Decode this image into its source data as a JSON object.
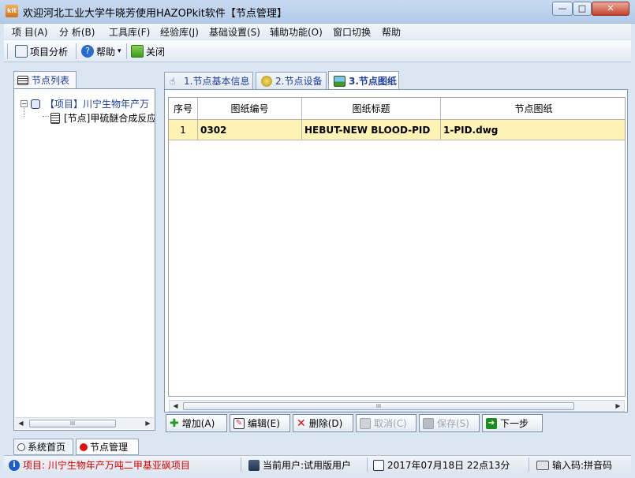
{
  "window": {
    "title": "欢迎河北工业大学牛晓芳使用HAZOPkit软件【节点管理】",
    "app_icon_text": "kit",
    "controls": {
      "minimize": "—",
      "maximize": "□",
      "close": "✕"
    }
  },
  "menubar": {
    "items": [
      "项 目(A)",
      "分 析(B)",
      "工具库(F)",
      "经验库(J)",
      "基础设置(S)",
      "辅助功能(O)",
      "窗口切换",
      "帮助"
    ]
  },
  "toolbar": {
    "analysis_label": "项目分析",
    "help_label": "帮助",
    "help_arrow": "▾",
    "close_label": "关闭"
  },
  "left_panel": {
    "tab_label": "节点列表",
    "tree": {
      "project_label": "【项目】川宁生物年产万",
      "node_label": "[节点]甲硫醚合成反应",
      "expand_sign": "−"
    },
    "scroll_thumb": "III"
  },
  "tabs": [
    "1.节点基本信息",
    "2.节点设备",
    "3.节点图纸"
  ],
  "active_tab": 2,
  "grid": {
    "columns": [
      "序号",
      "图纸编号",
      "图纸标题",
      "节点图纸"
    ],
    "rows": [
      {
        "index": "1",
        "drawing_no": "0302",
        "title": "HEBUT-NEW BLOOD-PID",
        "file": "1-PID.dwg"
      }
    ],
    "scroll_thumb": "III"
  },
  "actions": {
    "add": "增加(A)",
    "edit": "编辑(E)",
    "delete": "删除(D)",
    "cancel": "取消(C)",
    "save": "保存(S)",
    "next": "下一步"
  },
  "bottom_tabs": [
    "系统首页",
    "节点管理"
  ],
  "status": {
    "project": "项目: 川宁生物年产万吨二甲基亚砜项目",
    "user": "当前用户:试用版用户",
    "datetime": "2017年07月18日  22点13分",
    "input": "输入码:拼音码"
  },
  "colors": {
    "status_project": "#d40000",
    "tab_text": "#1d3e9e",
    "selected_row": "#fff2b5"
  }
}
